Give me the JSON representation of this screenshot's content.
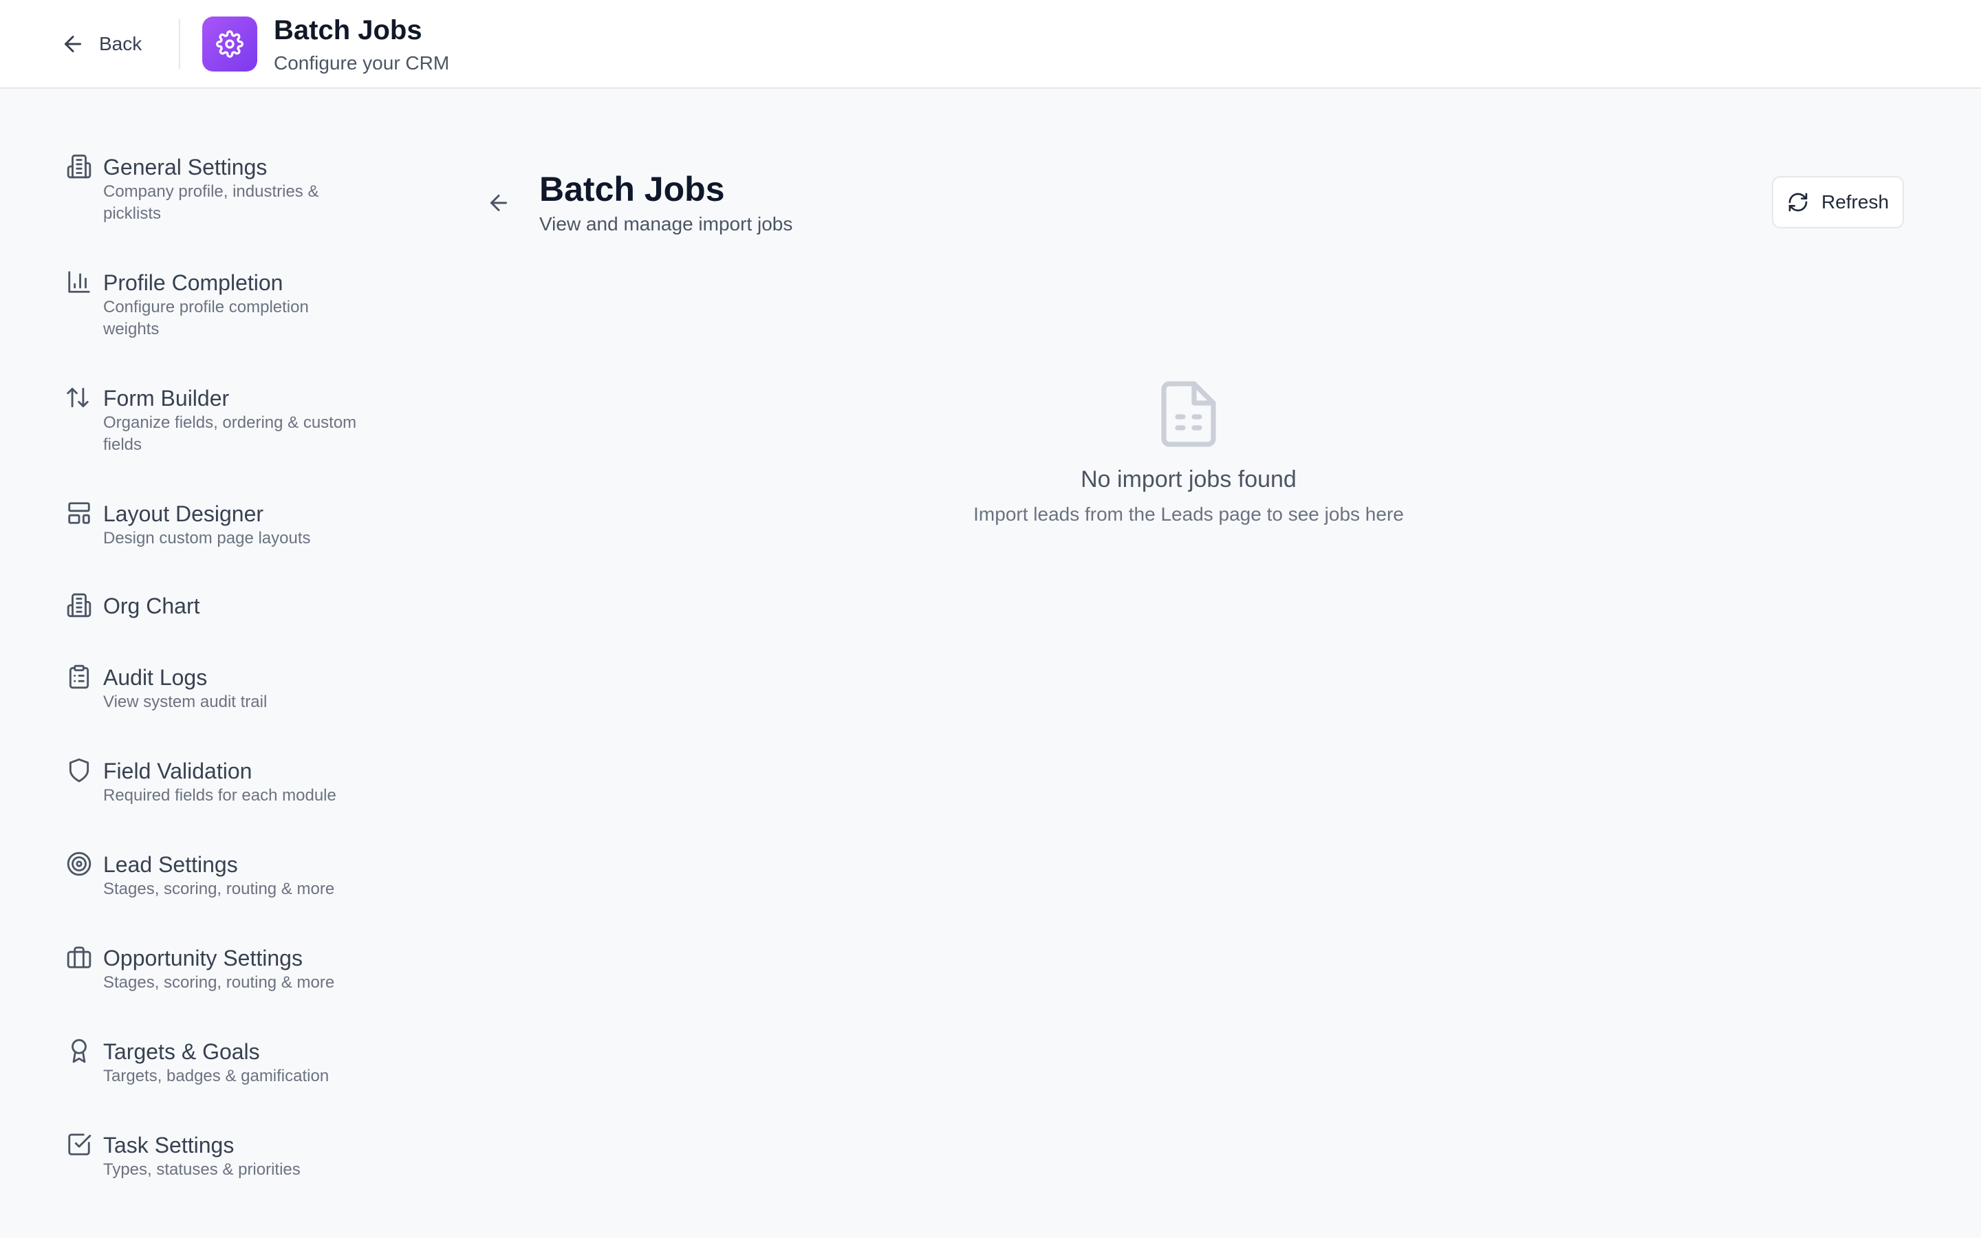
{
  "header": {
    "back_label": "Back",
    "app_title": "Batch Jobs",
    "app_subtitle": "Configure your CRM",
    "app_icon": "gear-icon",
    "accent_color": "#8b5cf6"
  },
  "sidebar": {
    "items": [
      {
        "icon": "building-icon",
        "title": "General Settings",
        "desc": "Company profile, industries & picklists"
      },
      {
        "icon": "bar-chart-icon",
        "title": "Profile Completion",
        "desc": "Configure profile completion weights"
      },
      {
        "icon": "arrows-up-down-icon",
        "title": "Form Builder",
        "desc": "Organize fields, ordering & custom fields"
      },
      {
        "icon": "layout-icon",
        "title": "Layout Designer",
        "desc": "Design custom page layouts"
      },
      {
        "icon": "building-icon",
        "title": "Org Chart",
        "desc": ""
      },
      {
        "icon": "clipboard-list-icon",
        "title": "Audit Logs",
        "desc": "View system audit trail"
      },
      {
        "icon": "shield-icon",
        "title": "Field Validation",
        "desc": "Required fields for each module"
      },
      {
        "icon": "target-icon",
        "title": "Lead Settings",
        "desc": "Stages, scoring, routing & more"
      },
      {
        "icon": "briefcase-icon",
        "title": "Opportunity Settings",
        "desc": "Stages, scoring, routing & more"
      },
      {
        "icon": "award-icon",
        "title": "Targets & Goals",
        "desc": "Targets, badges & gamification"
      },
      {
        "icon": "check-square-icon",
        "title": "Task Settings",
        "desc": "Types, statuses & priorities"
      }
    ]
  },
  "main": {
    "title": "Batch Jobs",
    "subtitle": "View and manage import jobs",
    "refresh_label": "Refresh",
    "empty_title": "No import jobs found",
    "empty_desc": "Import leads from the Leads page to see jobs here",
    "empty_icon": "file-text-icon"
  }
}
